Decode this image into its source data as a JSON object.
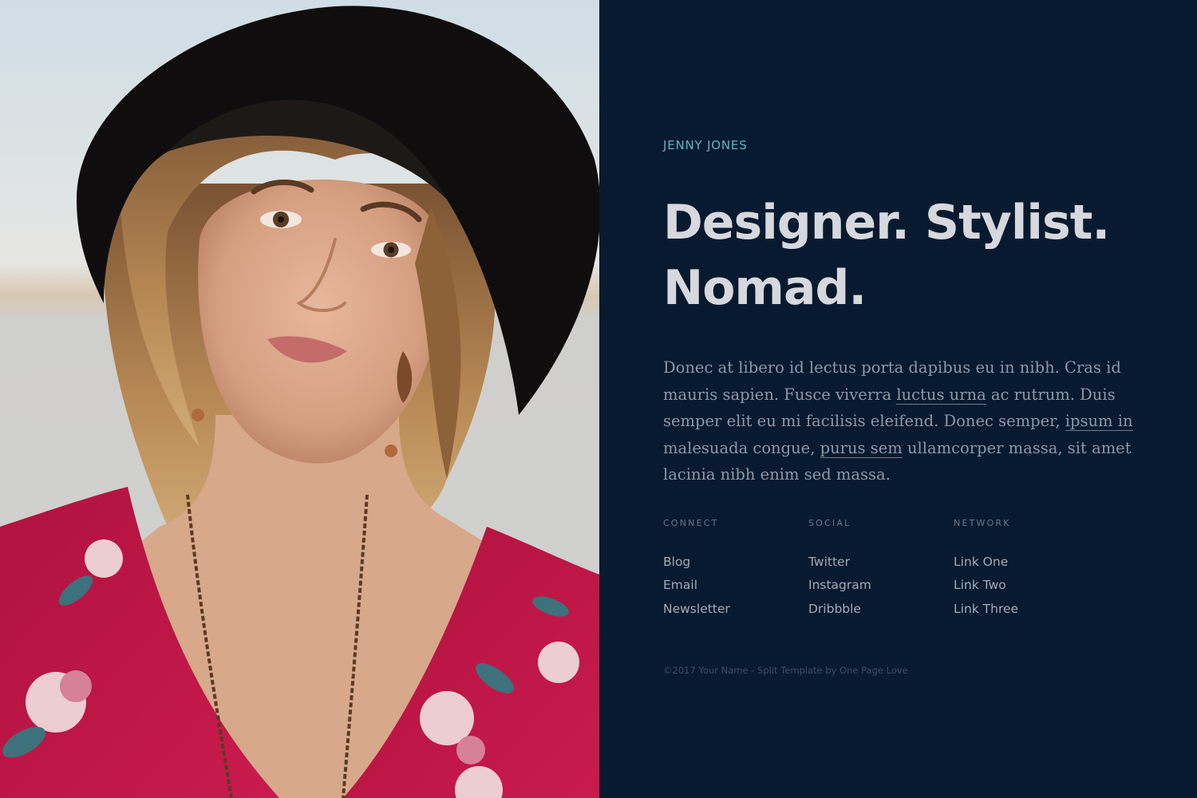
{
  "profile": {
    "name": "JENNY JONES",
    "headline_line1": "Designer. Stylist.",
    "headline_line2": "Nomad."
  },
  "bio": {
    "part1": "Donec at libero id lectus porta dapibus eu in nibh. Cras id mauris sapien. Fusce viverra ",
    "link1": "luctus urna",
    "part2": " ac rutrum. Duis semper elit eu mi facilisis eleifend. Donec semper, ",
    "link2": "ipsum in",
    "part3": " malesuada congue, ",
    "link3": "purus sem",
    "part4": " ullamcorper massa, sit amet lacinia nibh enim sed massa."
  },
  "columns": [
    {
      "heading": "CONNECT",
      "links": [
        "Blog",
        "Email",
        "Newsletter"
      ]
    },
    {
      "heading": "SOCIAL",
      "links": [
        "Twitter",
        "Instagram",
        "Dribbble"
      ]
    },
    {
      "heading": "NETWORK",
      "links": [
        "Link One",
        "Link Two",
        "Link Three"
      ]
    }
  ],
  "footer": {
    "text": "©2017 Your Name - Split Template by One Page Love"
  },
  "colors": {
    "background": "#081a2f",
    "accent": "#5bb6c4",
    "headline": "#d6d8de",
    "body_text": "#8d98a8"
  }
}
